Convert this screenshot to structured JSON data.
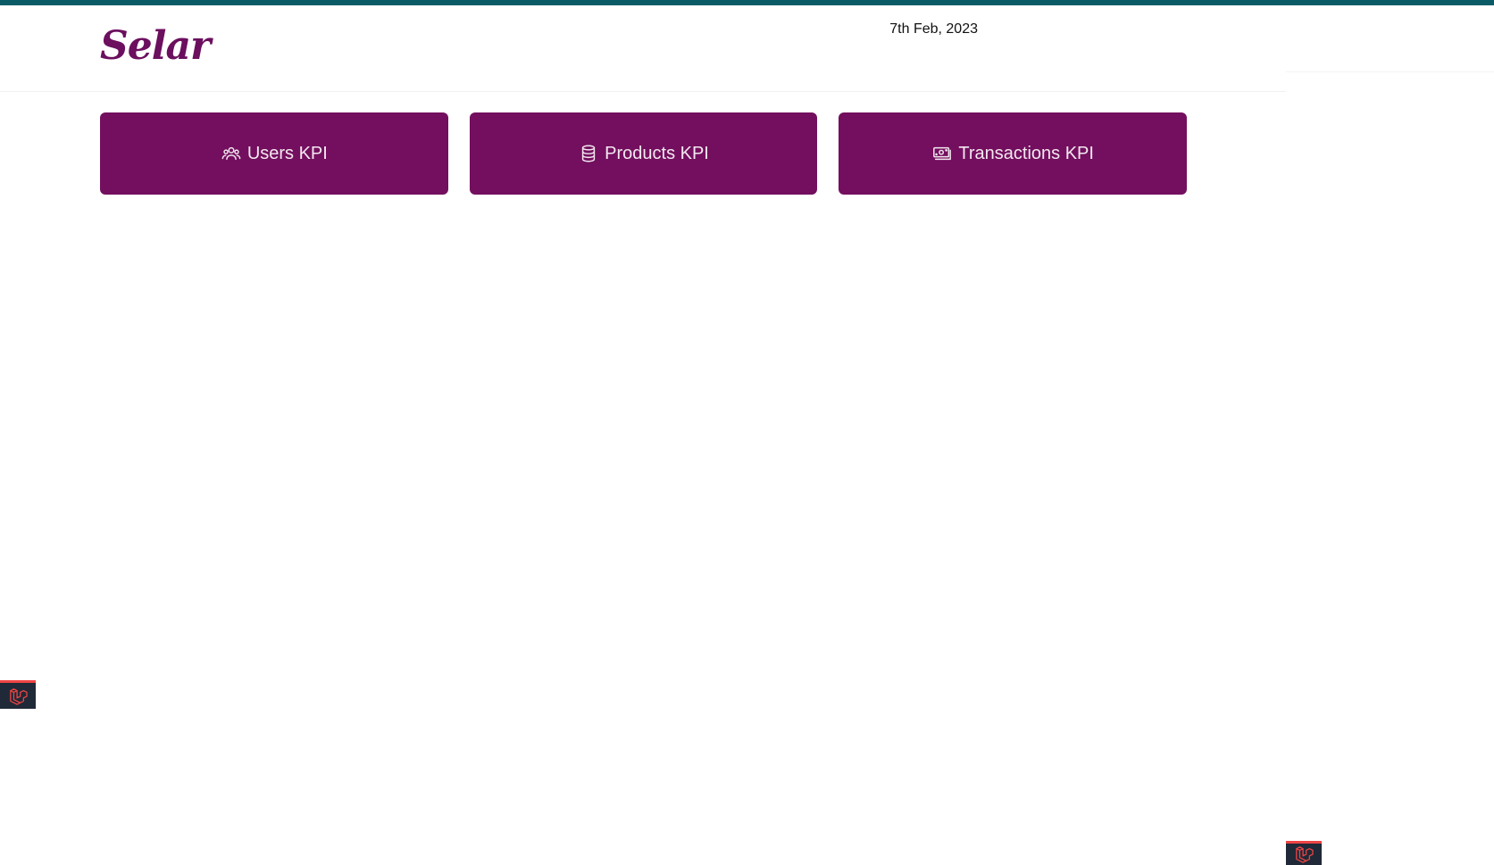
{
  "brand": {
    "logo_text": "Selar",
    "logo_color": "#6b0f5e",
    "accent_top_strip": "#0b5b66"
  },
  "header": {
    "date": "7th Feb, 2023"
  },
  "kpi_buttons": [
    {
      "label": "Users KPI",
      "icon": "users-icon"
    },
    {
      "label": "Products KPI",
      "icon": "database-icon"
    },
    {
      "label": "Transactions KPI",
      "icon": "cash-icon"
    }
  ],
  "colors": {
    "kpi_bg": "#730f5e",
    "kpi_text": "#f3e8f0",
    "debug_badge_bg": "#1f2937",
    "debug_badge_accent": "#ef4444"
  },
  "debug_badges": [
    {
      "icon": "laravel-icon"
    },
    {
      "icon": "laravel-icon"
    }
  ]
}
